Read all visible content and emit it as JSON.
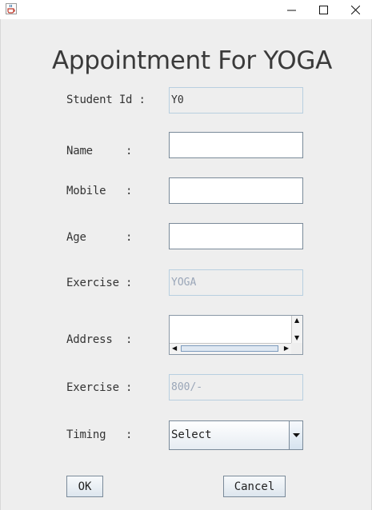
{
  "window": {
    "icon": "java-cup-icon",
    "controls": {
      "minimize": "–",
      "maximize": "☐",
      "close": "✕"
    }
  },
  "form": {
    "title": "Appointment For YOGA",
    "fields": [
      {
        "label": "Student Id :",
        "value": "Y0"
      },
      {
        "label": "Name     :",
        "value": ""
      },
      {
        "label": "Mobile   :",
        "value": ""
      },
      {
        "label": "Age      :",
        "value": ""
      },
      {
        "label": "Exercise :",
        "value": "YOGA"
      },
      {
        "label": "Address  :",
        "value": ""
      },
      {
        "label": "Exercise :",
        "value": "800/-"
      },
      {
        "label": "Timing   :",
        "value": "Select"
      }
    ],
    "buttons": {
      "ok": "OK",
      "cancel": "Cancel"
    }
  }
}
